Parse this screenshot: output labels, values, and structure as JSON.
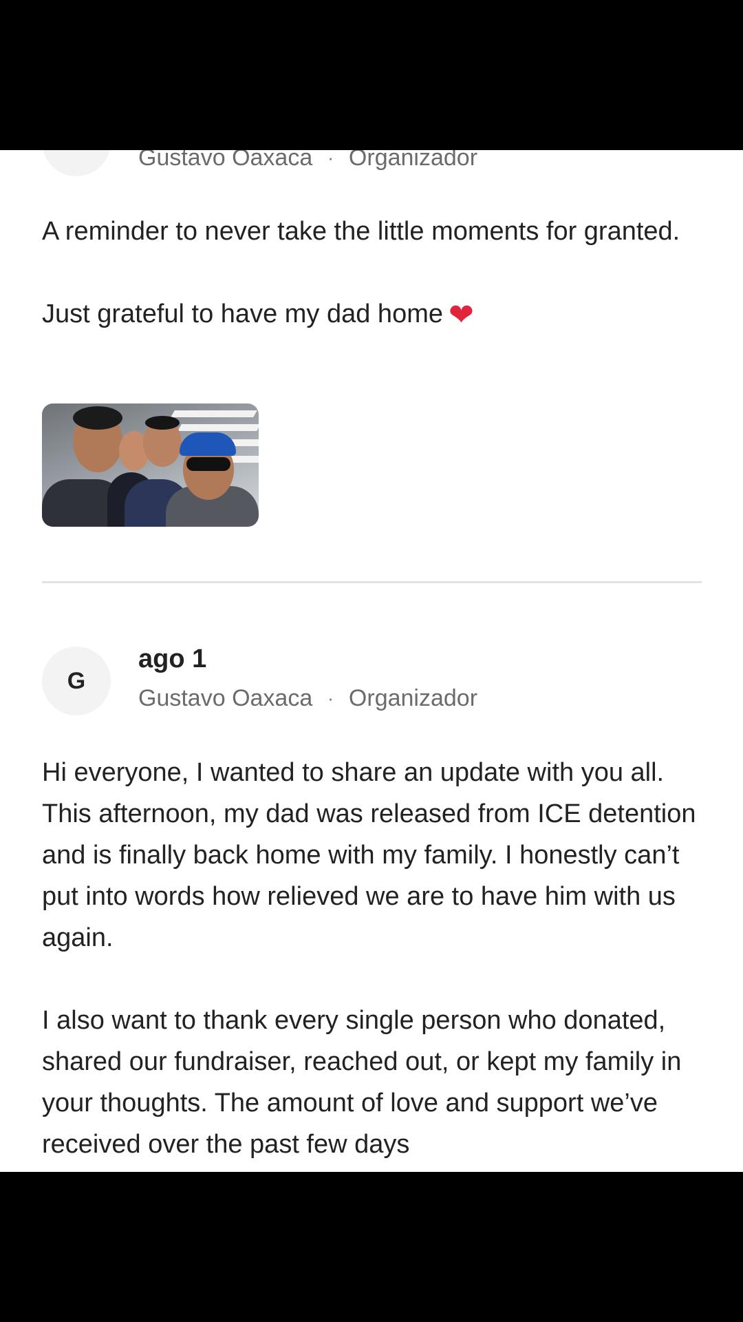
{
  "updates": [
    {
      "author": "Gustavo Oaxaca",
      "separator": "·",
      "role": "Organizador",
      "paragraphs": [
        "A reminder to never take the little moments for granted.",
        "Just grateful to have my dad home"
      ],
      "emoji": "❤",
      "has_photo": true
    },
    {
      "avatar_letter": "G",
      "date": "ago 1",
      "author": "Gustavo Oaxaca",
      "separator": "·",
      "role": "Organizador",
      "paragraphs": [
        "Hi everyone, I wanted to share an update with you all. This afternoon, my dad was released from ICE detention and is finally back home with my family. I honestly can’t put into words how relieved we are to have him with us again.",
        "I also want to thank every single person who donated, shared our fundraiser, reached out, or kept my family in your thoughts. The amount of love and support we’ve received over the past few days"
      ]
    }
  ],
  "colors": {
    "text": "#222222",
    "meta": "#6b6b6b",
    "divider": "#e2e2e2",
    "avatar_bg": "#f3f3f3",
    "heart": "#e0243a"
  }
}
